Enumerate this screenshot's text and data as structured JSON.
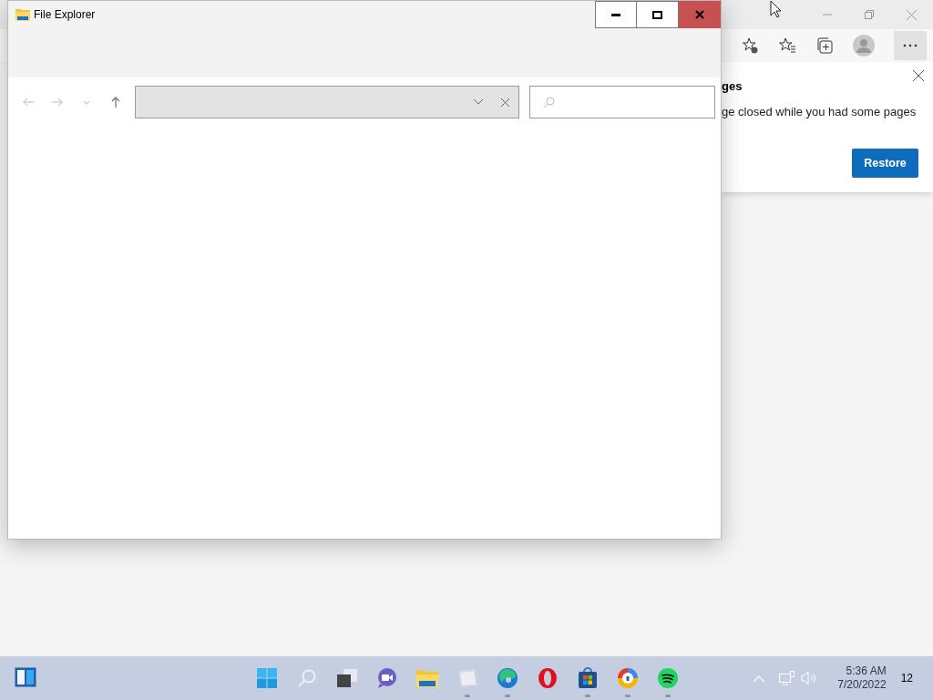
{
  "explorer": {
    "title": "File Explorer",
    "nav_buttons": [
      {
        "kind": "back",
        "disabled": true
      },
      {
        "kind": "forward",
        "disabled": true
      },
      {
        "kind": "recent",
        "disabled": true
      },
      {
        "kind": "up",
        "disabled": false
      }
    ]
  },
  "browser": {
    "popup": {
      "heading": "ges",
      "message": "ge closed while you had some pages",
      "button": "Restore"
    }
  },
  "taskbar": {
    "apps": [
      {
        "kind": "start",
        "running": false
      },
      {
        "kind": "search",
        "running": false
      },
      {
        "kind": "taskview",
        "running": false
      },
      {
        "kind": "chat",
        "running": false
      },
      {
        "kind": "explorer",
        "running": false
      },
      {
        "kind": "photos",
        "running": true
      },
      {
        "kind": "edge",
        "running": true
      },
      {
        "kind": "opera",
        "running": false
      },
      {
        "kind": "store",
        "running": true
      },
      {
        "kind": "vpn",
        "running": true
      },
      {
        "kind": "spotify",
        "running": true
      }
    ],
    "time": "5:36 AM",
    "date": "7/20/2022",
    "notifications": "12"
  }
}
